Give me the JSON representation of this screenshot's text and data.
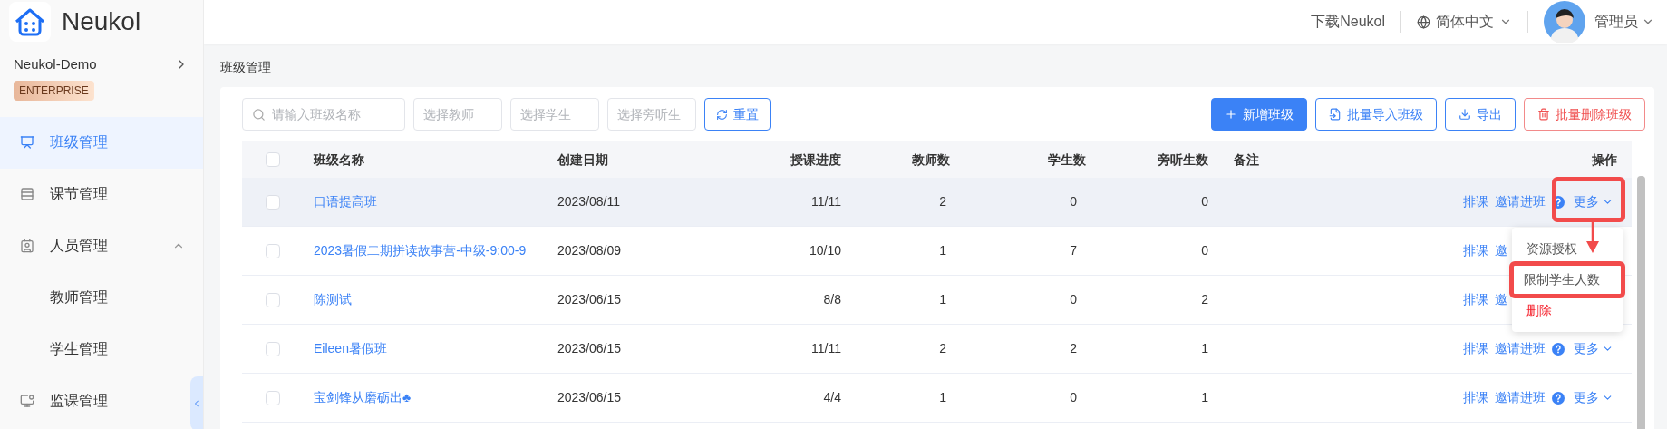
{
  "logo": {
    "text": "Neukol"
  },
  "org": {
    "name": "Neukol-Demo",
    "badge": "ENTERPRISE"
  },
  "menu": [
    {
      "label": "班级管理",
      "selected": true
    },
    {
      "label": "课节管理",
      "selected": false
    },
    {
      "label": "人员管理",
      "selected": false,
      "expanded": true,
      "children": [
        {
          "label": "教师管理",
          "selected": false
        },
        {
          "label": "学生管理",
          "selected": false
        }
      ]
    },
    {
      "label": "监课管理",
      "selected": false
    }
  ],
  "topbar": {
    "download": "下载Neukol",
    "language": "简体中文",
    "user": "管理员"
  },
  "breadcrumb": "班级管理",
  "filters": [
    {
      "kind": "search",
      "placeholder": "请输入班级名称"
    },
    {
      "kind": "select",
      "placeholder": "选择教师"
    },
    {
      "kind": "select",
      "placeholder": "选择学生"
    },
    {
      "kind": "select",
      "placeholder": "选择旁听生"
    }
  ],
  "reset": "重置",
  "actions": [
    {
      "kind": "primary",
      "label": "新增班级"
    },
    {
      "kind": "import",
      "label": "批量导入班级"
    },
    {
      "kind": "export",
      "label": "导出"
    },
    {
      "kind": "danger",
      "label": "批量删除班级"
    }
  ],
  "table": {
    "all_checked": false,
    "columns": [
      "班级名称",
      "创建日期",
      "授课进度",
      "教师数",
      "学生数",
      "旁听生数",
      "备注",
      "操作"
    ],
    "rows": [
      {
        "checked": false,
        "highlighted": true,
        "name": "口语提高班",
        "date": "2023/08/11",
        "progress": "11/11",
        "teachers": "2",
        "students": "0",
        "auditors": "0",
        "ops": [
          {
            "kind": "link",
            "label": "排课"
          },
          {
            "kind": "link",
            "label": "邀请进班"
          },
          {
            "kind": "help"
          },
          {
            "kind": "more",
            "label": "更多"
          }
        ]
      },
      {
        "checked": false,
        "highlighted": false,
        "name": "2023暑假二期拼读故事营-中级-9:00-9",
        "date": "2023/08/09",
        "progress": "10/10",
        "teachers": "1",
        "students": "7",
        "auditors": "0",
        "ops": [
          {
            "kind": "link",
            "label": "排课"
          },
          {
            "kind": "link",
            "label": "邀"
          }
        ]
      },
      {
        "checked": false,
        "highlighted": false,
        "name": "陈测试",
        "date": "2023/06/15",
        "progress": "8/8",
        "teachers": "1",
        "students": "0",
        "auditors": "2",
        "ops": [
          {
            "kind": "link",
            "label": "排课"
          },
          {
            "kind": "link",
            "label": "邀"
          }
        ]
      },
      {
        "checked": false,
        "highlighted": false,
        "name": "Eileen暑假班",
        "date": "2023/06/15",
        "progress": "11/11",
        "teachers": "2",
        "students": "2",
        "auditors": "1",
        "ops": [
          {
            "kind": "link",
            "label": "排课"
          },
          {
            "kind": "link",
            "label": "邀请进班"
          },
          {
            "kind": "help"
          },
          {
            "kind": "more",
            "label": "更多"
          }
        ]
      },
      {
        "checked": false,
        "highlighted": false,
        "name": "宝剑锋从磨砺出♣",
        "date": "2023/06/15",
        "progress": "4/4",
        "teachers": "1",
        "students": "0",
        "auditors": "1",
        "ops": [
          {
            "kind": "link",
            "label": "排课"
          },
          {
            "kind": "link",
            "label": "邀请进班"
          },
          {
            "kind": "help"
          },
          {
            "kind": "more",
            "label": "更多"
          }
        ]
      }
    ]
  },
  "dropdown": {
    "items": [
      {
        "kind": "normal",
        "label": "资源授权",
        "annotated": false
      },
      {
        "kind": "normal",
        "label": "限制学生人数",
        "annotated": true
      },
      {
        "kind": "danger",
        "label": "删除",
        "annotated": false
      }
    ]
  }
}
